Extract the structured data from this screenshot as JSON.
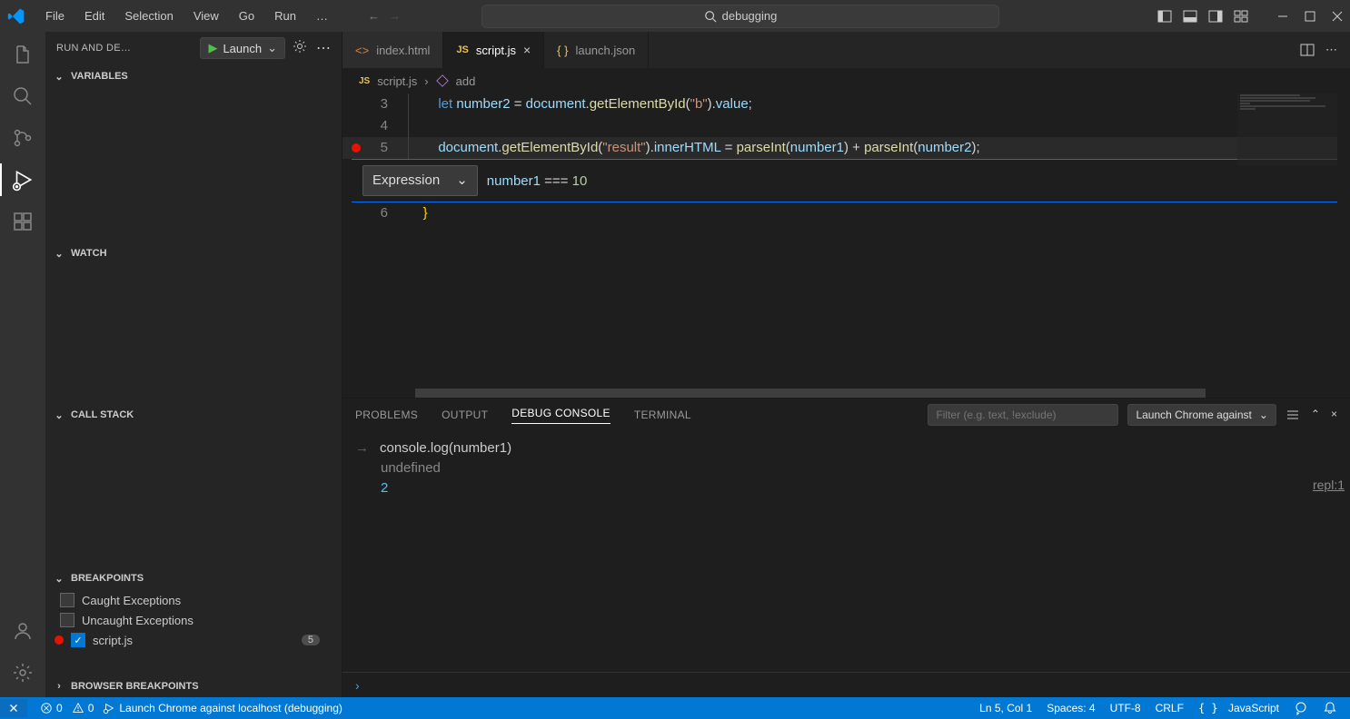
{
  "titlebar": {
    "menu": [
      "File",
      "Edit",
      "Selection",
      "View",
      "Go",
      "Run",
      "…"
    ],
    "search": "debugging"
  },
  "sidebar": {
    "title": "RUN AND DE…",
    "launch_label": "Launch",
    "sections": {
      "variables": "VARIABLES",
      "watch": "WATCH",
      "callstack": "CALL STACK",
      "breakpoints": "BREAKPOINTS",
      "browser_breakpoints": "BROWSER BREAKPOINTS"
    },
    "breakpoints": {
      "caught": "Caught Exceptions",
      "uncaught": "Uncaught Exceptions",
      "file": "script.js",
      "count": "5"
    }
  },
  "tabs": [
    {
      "label": "index.html",
      "icon": "html",
      "active": false
    },
    {
      "label": "script.js",
      "icon": "js",
      "active": true
    },
    {
      "label": "launch.json",
      "icon": "json",
      "active": false
    }
  ],
  "breadcrumb": {
    "file": "script.js",
    "symbol": "add"
  },
  "code": {
    "l3": {
      "no": "3",
      "text_prefix": "let ",
      "var": "number2",
      "eq": " = ",
      "obj": "document",
      "dot1": ".",
      "fn": "getElementById",
      "paren1": "(",
      "str": "\"b\"",
      "paren2": ").",
      "prop": "value",
      "semi": ";"
    },
    "l4": {
      "no": "4"
    },
    "l5": {
      "no": "5",
      "obj": "document",
      "dot": ".",
      "fn": "getElementById",
      "p1": "(",
      "str": "\"result\"",
      "p2": ").",
      "prop": "innerHTML",
      "eq": " = ",
      "fn2": "parseInt",
      "p3": "(",
      "v1": "number1",
      "p4": ") + ",
      "fn3": "parseInt",
      "p5": "(",
      "v2": "number2",
      "p6": ");"
    },
    "l6": {
      "no": "6",
      "brace": "}"
    }
  },
  "logpoint": {
    "dropdown": "Expression",
    "expr_var": "number1",
    "expr_op": " === ",
    "expr_num": "10"
  },
  "panel": {
    "tabs": [
      "PROBLEMS",
      "OUTPUT",
      "DEBUG CONSOLE",
      "TERMINAL"
    ],
    "filter_placeholder": "Filter (e.g. text, !exclude)",
    "target": "Launch Chrome against"
  },
  "console": {
    "input": "console.log(number1)",
    "undefined": "undefined",
    "result": "2",
    "source": "repl:1"
  },
  "statusbar": {
    "errors": "0",
    "warnings": "0",
    "launch": "Launch Chrome against localhost (debugging)",
    "lncol": "Ln 5, Col 1",
    "spaces": "Spaces: 4",
    "encoding": "UTF-8",
    "eol": "CRLF",
    "lang": "JavaScript"
  }
}
